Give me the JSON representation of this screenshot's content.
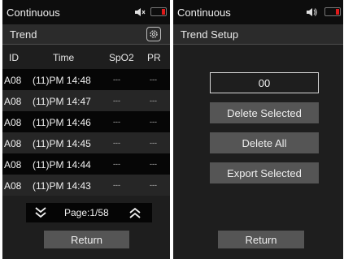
{
  "left": {
    "status_title": "Continuous",
    "header_title": "Trend",
    "columns": [
      "ID",
      "Time",
      "SpO2",
      "PR"
    ],
    "rows": [
      {
        "id": "A08",
        "time": "(11)PM 14:48",
        "spo2": "---",
        "pr": "---"
      },
      {
        "id": "A08",
        "time": "(11)PM 14:47",
        "spo2": "---",
        "pr": "---"
      },
      {
        "id": "A08",
        "time": "(11)PM 14:46",
        "spo2": "---",
        "pr": "---"
      },
      {
        "id": "A08",
        "time": "(11)PM 14:45",
        "spo2": "---",
        "pr": "---"
      },
      {
        "id": "A08",
        "time": "(11)PM 14:44",
        "spo2": "---",
        "pr": "---"
      },
      {
        "id": "A08",
        "time": "(11)PM 14:43",
        "spo2": "---",
        "pr": "---"
      }
    ],
    "page_label": "Page:1/58",
    "return_label": "Return"
  },
  "right": {
    "status_title": "Continuous",
    "header_title": "Trend Setup",
    "code_value": "00",
    "delete_selected_label": "Delete Selected",
    "delete_all_label": "Delete All",
    "export_selected_label": "Export Selected",
    "return_label": "Return"
  },
  "icons": {
    "speaker": "speaker-muted-icon",
    "battery": "battery-low-icon",
    "settings": "gear-icon",
    "page_down": "double-chevron-down-icon",
    "page_up": "double-chevron-up-icon"
  },
  "colors": {
    "battery_low": "#e01a1a",
    "button_bg": "#555555",
    "screen_bg": "#1e1e1e"
  }
}
